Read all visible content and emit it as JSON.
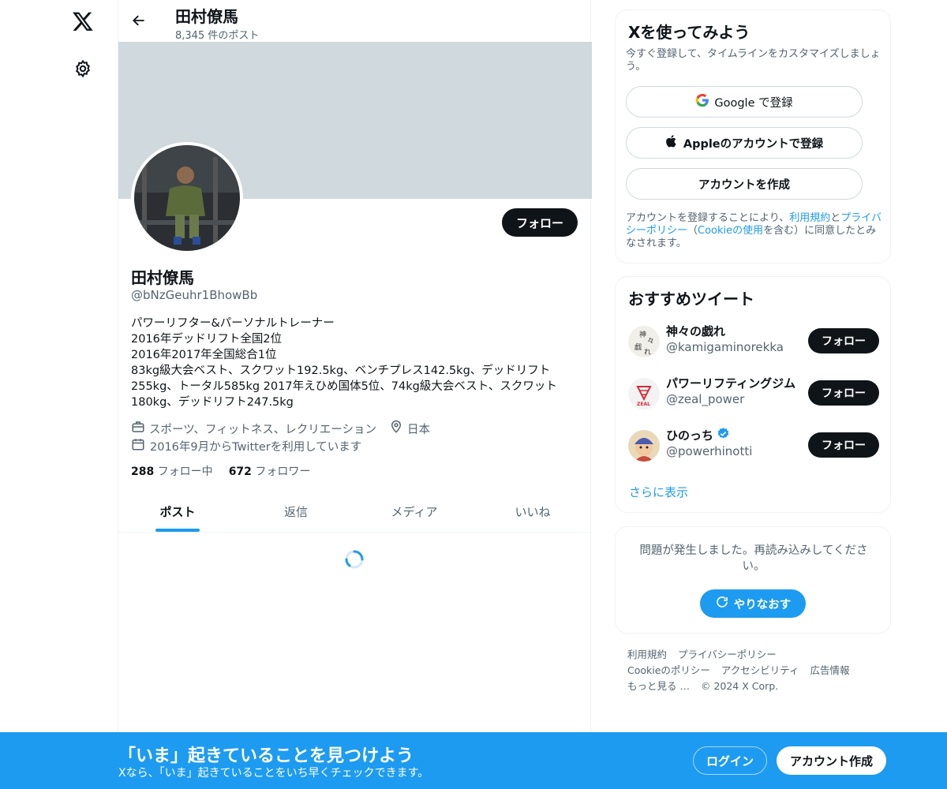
{
  "colors": {
    "accent": "#1d9bf0",
    "dark": "#0f1419",
    "muted": "#536471",
    "banner": "#cfd9de"
  },
  "nav": {
    "logo_icon": "x-logo-icon",
    "settings_icon": "gear-icon"
  },
  "header": {
    "name": "田村僚馬",
    "post_count": "8,345 件のポスト",
    "back_icon": "arrow-left-icon"
  },
  "profile": {
    "name": "田村僚馬",
    "handle": "@bNzGeuhr1BhowBb",
    "follow_label": "フォロー",
    "bio_lines": [
      "パワーリフター&パーソナルトレーナー",
      "2016年デッドリフト全国2位",
      "2016年2017年全国総合1位",
      "83kg級大会ベスト、スクワット192.5kg、ベンチプレス142.5kg、デッドリフト",
      "255kg、トータル585kg 2017年えひめ国体5位、74kg級大会ベスト、スクワット",
      "180kg、デッドリフト247.5kg"
    ],
    "category": "スポーツ、フィットネス、レクリエーション",
    "location": "日本",
    "joined": "2016年9月からTwitterを利用しています",
    "following_count": "288",
    "following_label": "フォロー中",
    "followers_count": "672",
    "followers_label": "フォロワー"
  },
  "tabs": [
    "ポスト",
    "返信",
    "メディア",
    "いいね"
  ],
  "signup_card": {
    "title": "Xを使ってみよう",
    "subtitle": "今すぐ登録して、タイムラインをカスタマイズしましょう。",
    "google_label": "Google で登録",
    "apple_label": "Appleのアカウントで登録",
    "create_label": "アカウントを作成",
    "legal_prefix": "アカウントを登録することにより、",
    "terms": "利用規約",
    "and": "と",
    "privacy": "プライバシーポリシー",
    "paren_open": "（",
    "cookie": "Cookieの使用",
    "legal_suffix": "を含む）に同意したとみなされます。"
  },
  "recommend": {
    "title": "おすすめツイート",
    "items": [
      {
        "name": "神々の戯れ",
        "handle": "@kamigaminorekka",
        "follow": "フォロー",
        "verified": false
      },
      {
        "name": "パワーリフティングジム ZEAL",
        "handle": "@zeal_power",
        "follow": "フォロー",
        "verified": false
      },
      {
        "name": "ひのっち",
        "handle": "@powerhinotti",
        "follow": "フォロー",
        "verified": true
      }
    ],
    "more_label": "さらに表示"
  },
  "error_card": {
    "message": "問題が発生しました。再読み込みしてください。",
    "retry_label": "やりなおす"
  },
  "footer": {
    "links": [
      "利用規約",
      "プライバシーポリシー",
      "Cookieのポリシー",
      "アクセシビリティ",
      "広告情報",
      "もっと見る …"
    ],
    "copyright": "© 2024 X Corp."
  },
  "bottom_bar": {
    "title": "「いま」起きていることを見つけよう",
    "subtitle": "Xなら、「いま」起きていることをいち早くチェックできます。",
    "login_label": "ログイン",
    "signup_label": "アカウント作成"
  }
}
